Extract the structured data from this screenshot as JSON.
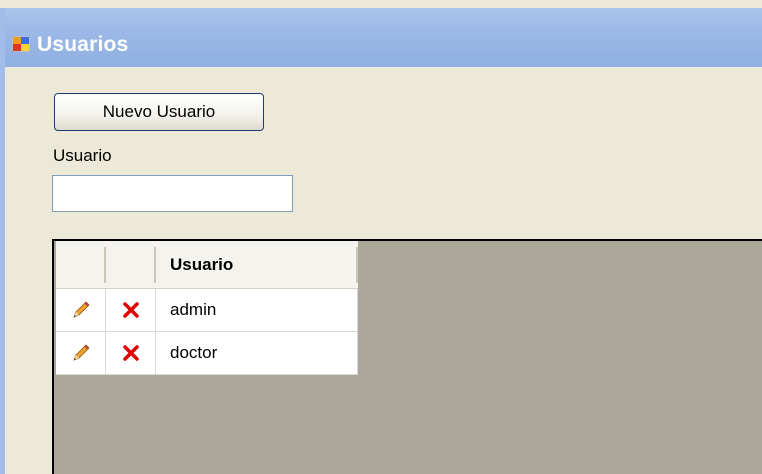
{
  "window": {
    "title": "Usuarios"
  },
  "toolbar": {
    "new_user_label": "Nuevo Usuario"
  },
  "filter": {
    "label": "Usuario",
    "value": ""
  },
  "grid": {
    "columns": [
      "",
      "",
      "Usuario"
    ],
    "rows": [
      {
        "usuario": "admin",
        "edit_icon": "pencil-icon",
        "delete_icon": "delete-x-icon"
      },
      {
        "usuario": "doctor",
        "edit_icon": "pencil-icon",
        "delete_icon": "delete-x-icon"
      }
    ]
  },
  "colors": {
    "window_bg": "#ece9d8",
    "titlebar": "#9cb8e6",
    "grid_bg": "#aba899",
    "delete_red": "#e00000"
  }
}
